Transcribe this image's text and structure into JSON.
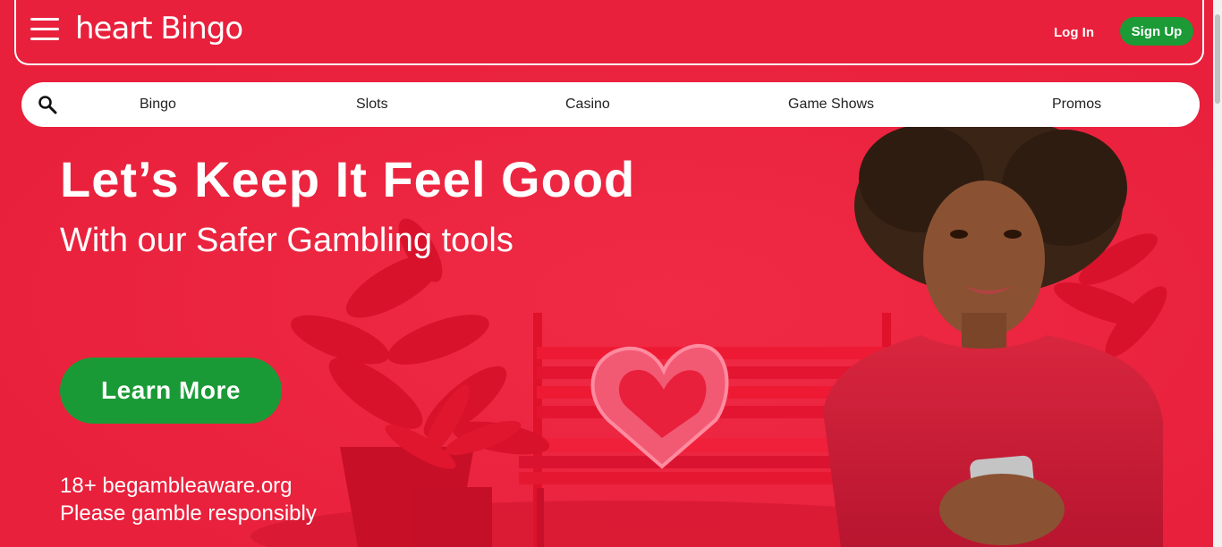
{
  "header": {
    "logo_text": "heart Bingo",
    "login_label": "Log In",
    "signup_label": "Sign Up"
  },
  "nav": {
    "items": [
      "Bingo",
      "Slots",
      "Casino",
      "Game Shows",
      "Promos"
    ]
  },
  "hero": {
    "headline": "Let’s Keep It Feel Good",
    "subhead": "With our Safer Gambling tools",
    "cta_label": "Learn More",
    "disclaimer_line1": "18+ begambleaware.org",
    "disclaimer_line2": "Please gamble responsibly"
  },
  "colors": {
    "brand_red": "#e8203c",
    "cta_green": "#1a9a36"
  },
  "icons": {
    "menu": "hamburger-menu-icon",
    "search": "search-icon"
  }
}
